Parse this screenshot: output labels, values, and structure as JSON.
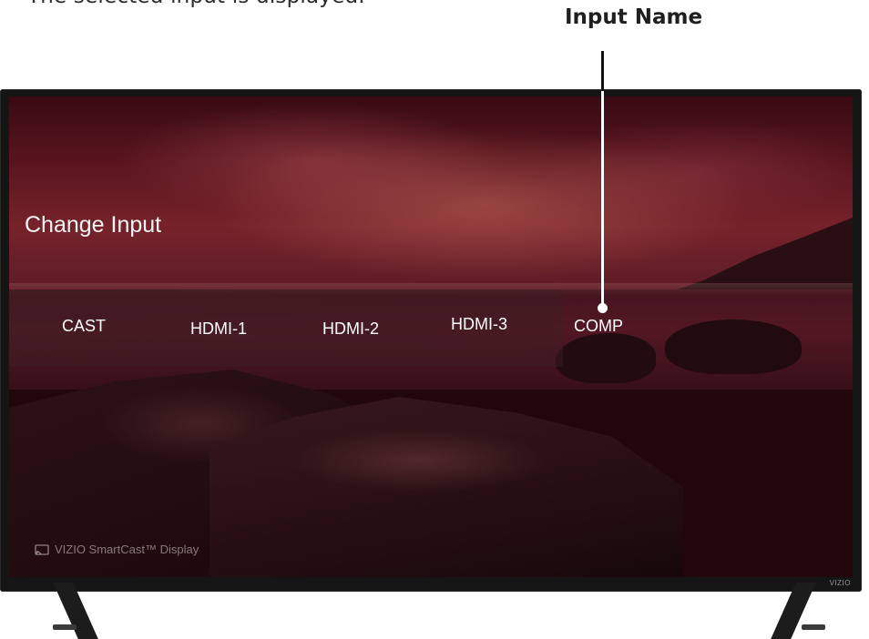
{
  "caption": "The selected input is displayed.",
  "callout": {
    "label": "Input Name"
  },
  "screen": {
    "menu_title": "Change Input",
    "inputs": [
      "CAST",
      "HDMI-1",
      "HDMI-2",
      "HDMI-3",
      "COMP"
    ],
    "selected_input": "COMP",
    "brand_text": "VIZIO SmartCast™ Display",
    "bezel_logo": "VIZIO"
  },
  "colors": {
    "accent": "#a0303a",
    "menu_text": "#ffffff"
  },
  "icons": [
    "cast-icon"
  ]
}
